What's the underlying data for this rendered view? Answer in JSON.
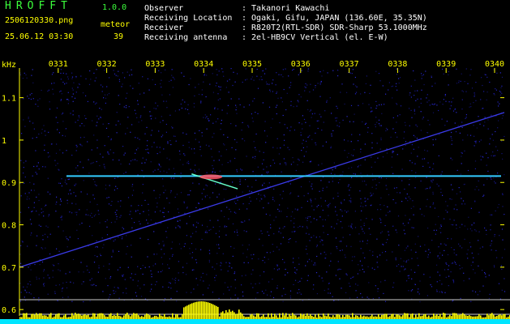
{
  "header": {
    "logo": "HROFFT",
    "version": "1.0.0",
    "filename": "2506120330.png",
    "datetime": "25.06.12 03:30",
    "meteor_label": "meteor",
    "meteor_count": "39",
    "info": [
      {
        "key": "Observer",
        "value": ": Takanori Kawachi"
      },
      {
        "key": "Receiving Location",
        "value": ": Ogaki, Gifu, JAPAN (136.60E, 35.35N)"
      },
      {
        "key": "Receiver",
        "value": ": R820T2(RTL-SDR) SDR-Sharp 53.1000MHz"
      },
      {
        "key": "Receiving antenna",
        "value": ": 2el-HB9CV Vertical (el. E-W)"
      }
    ]
  },
  "chart_data": {
    "type": "heatmap",
    "ylabel": "kHz",
    "x_ticks": [
      "0331",
      "0332",
      "0333",
      "0334",
      "0335",
      "0336",
      "0337",
      "0338",
      "0339",
      "0340"
    ],
    "y_ticks": [
      1.1,
      1.0,
      0.9,
      0.8,
      0.7,
      0.6
    ],
    "ylim": [
      0.585,
      1.17
    ],
    "colors": {
      "axis": "#ffff00",
      "carrier": "#33ccff",
      "noise": "#1a1aa0",
      "spectrum": "#ffff00",
      "base": "#00e5ff"
    },
    "carrier_khz": 0.915,
    "drift_line": {
      "start": [
        0.0,
        0.7
      ],
      "end": [
        10.0,
        1.065
      ]
    },
    "meteor_echo": {
      "t_start": 3.55,
      "t_end": 4.5,
      "khz_start": 0.92,
      "khz_end": 0.885
    }
  }
}
